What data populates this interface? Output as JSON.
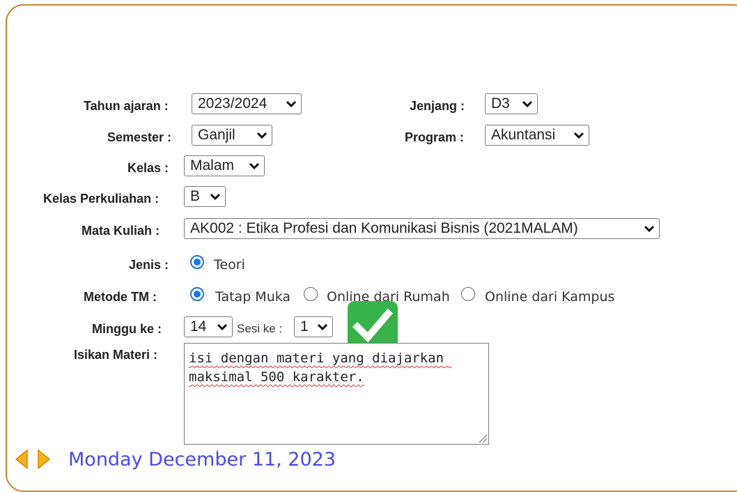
{
  "form": {
    "tahun_ajaran": {
      "label": "Tahun ajaran :",
      "value": "2023/2024"
    },
    "jenjang": {
      "label": "Jenjang :",
      "value": "D3"
    },
    "semester": {
      "label": "Semester :",
      "value": "Ganjil"
    },
    "program": {
      "label": "Program :",
      "value": "Akuntansi"
    },
    "kelas": {
      "label": "Kelas :",
      "value": "Malam"
    },
    "kelas_perkuliahan": {
      "label": "Kelas Perkuliahan :",
      "value": "B"
    },
    "mata_kuliah": {
      "label": "Mata Kuliah :",
      "value": "AK002 : Etika Profesi dan Komunikasi Bisnis (2021MALAM)"
    },
    "jenis": {
      "label": "Jenis :",
      "options": [
        "Teori"
      ],
      "selected": "Teori"
    },
    "metode_tm": {
      "label": "Metode TM :",
      "options": [
        "Tatap Muka",
        "Online dari Rumah",
        "Online dari Kampus"
      ],
      "selected": "Tatap Muka"
    },
    "minggu_ke": {
      "label": "Minggu ke :",
      "value": "14"
    },
    "sesi_ke": {
      "label": "Sesi ke :",
      "value": "1"
    },
    "materi": {
      "label": "Isikan Materi :",
      "placeholder": "isi dengan materi yang diajarkan maksimal 500 karakter."
    }
  },
  "footer": {
    "date": "Monday December 11, 2023"
  },
  "icons": {
    "checkmark": "check-mark-button-icon",
    "prev": "arrow-left-icon",
    "next": "arrow-right-icon"
  },
  "colors": {
    "frame_border": "#c9862a",
    "radio_accent": "#1a73e8",
    "date_text": "#4a4ae8",
    "check_badge": "#37b34a"
  }
}
